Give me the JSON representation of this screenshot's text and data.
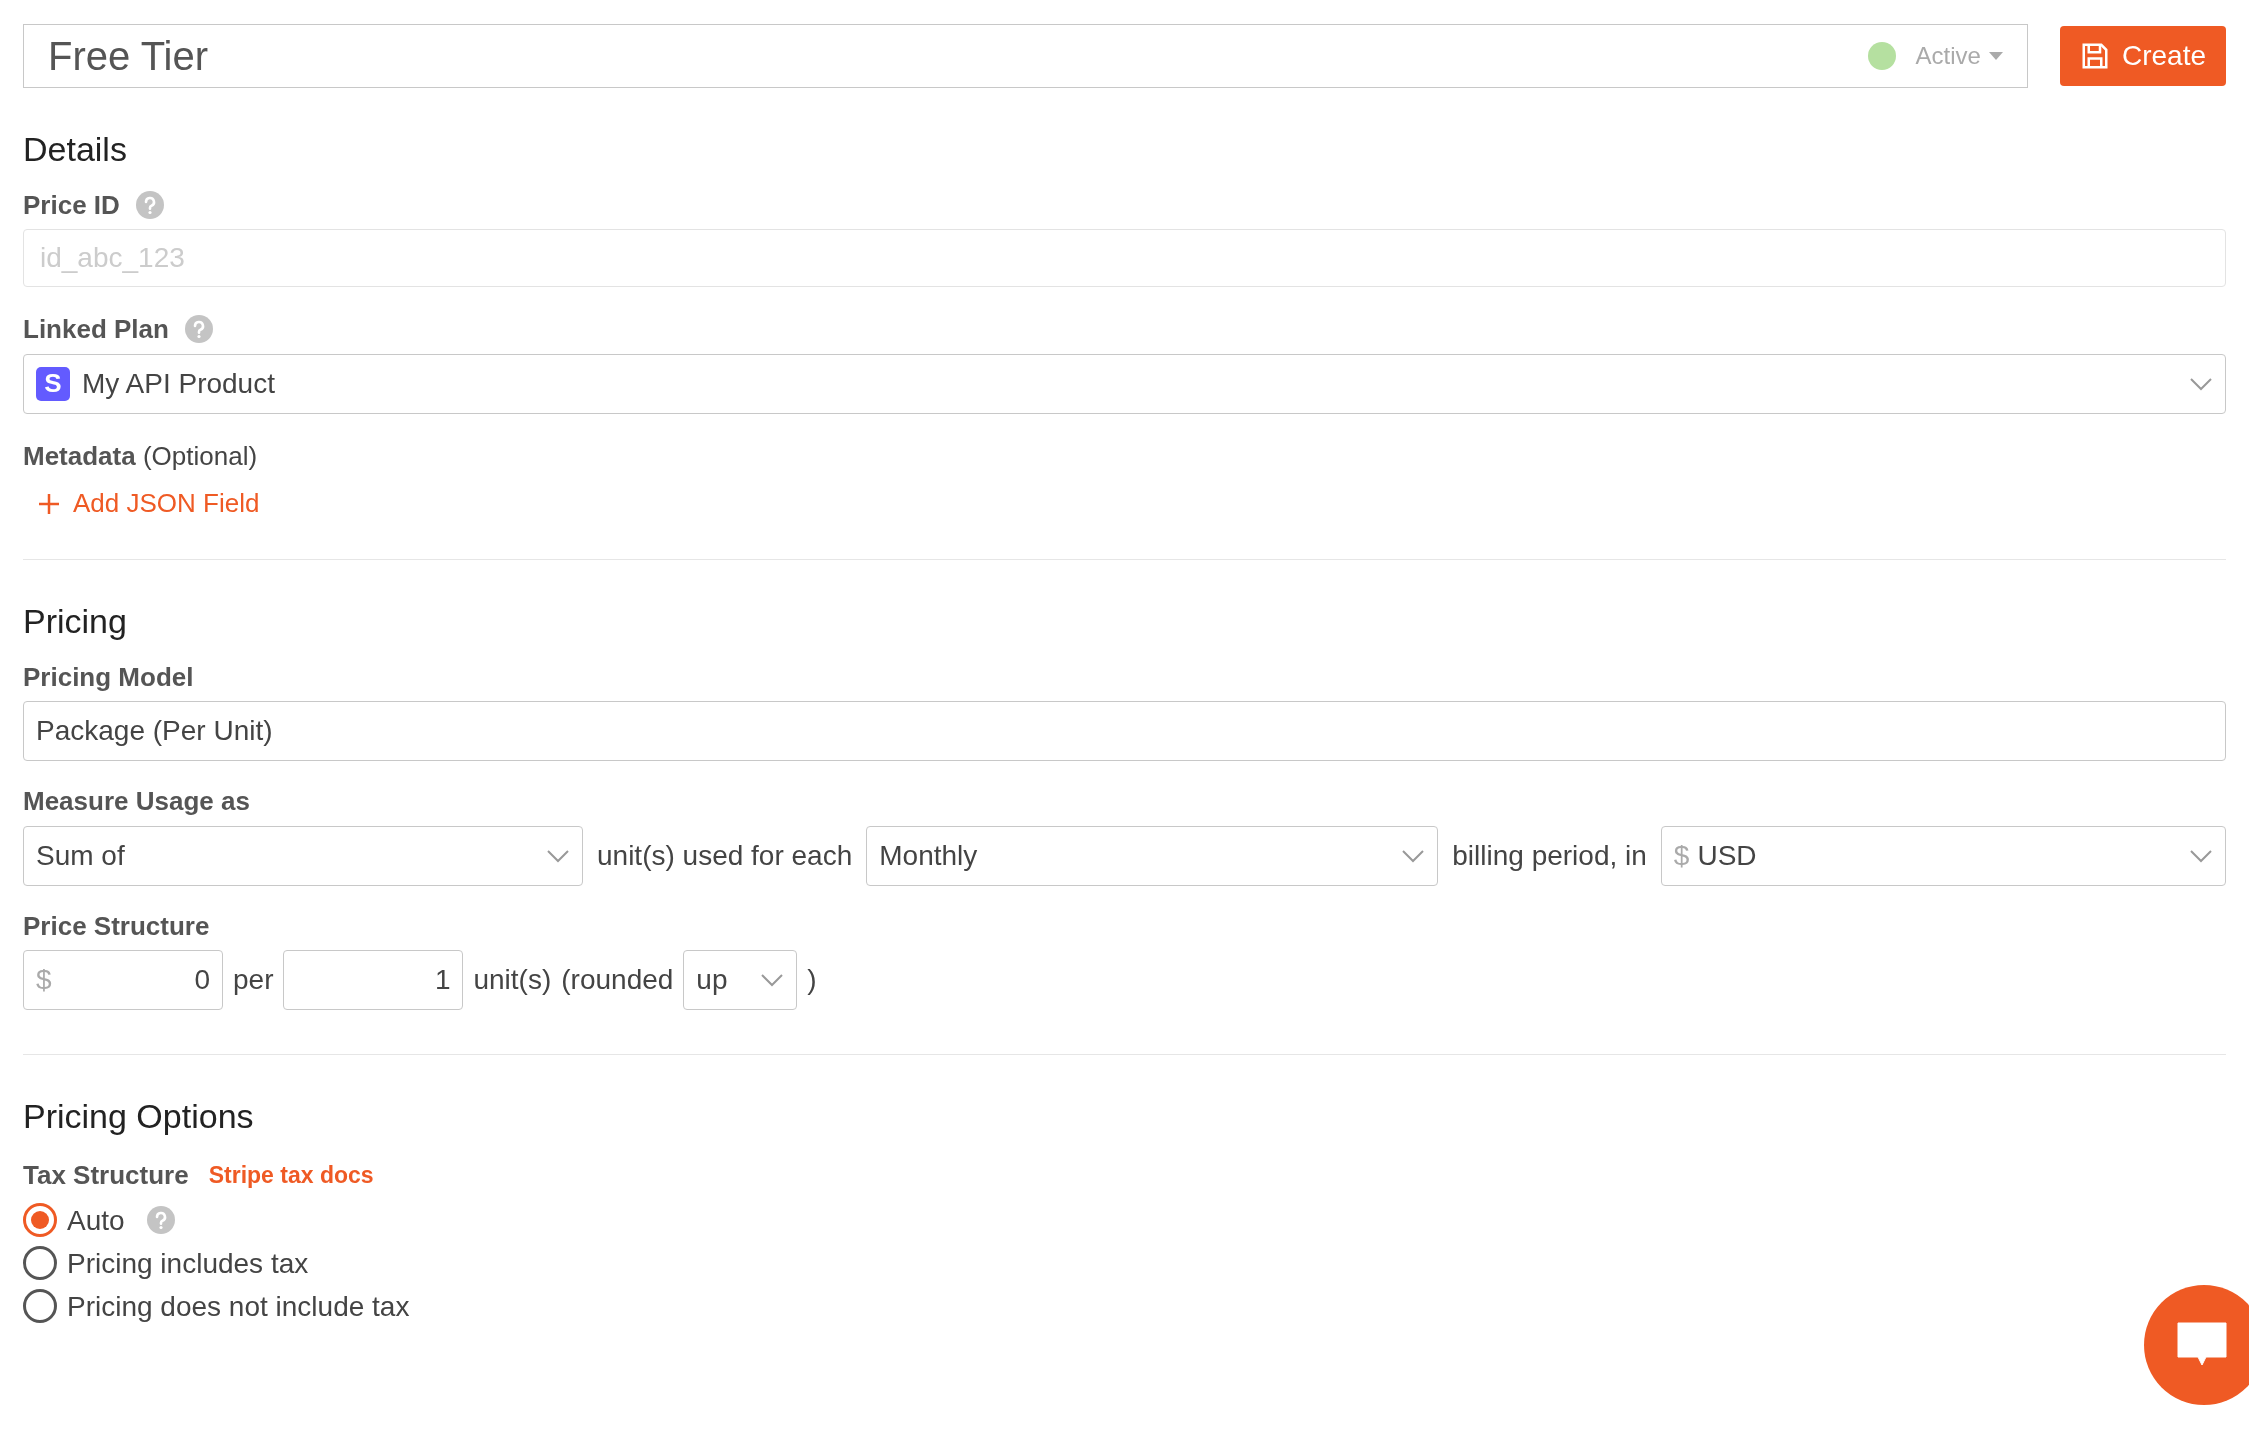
{
  "header": {
    "name": "Free Tier",
    "status": {
      "label": "Active",
      "color": "#b5e0a0"
    },
    "create_button": "Create"
  },
  "details": {
    "title": "Details",
    "price_id": {
      "label": "Price ID",
      "placeholder": "id_abc_123"
    },
    "linked_plan": {
      "label": "Linked Plan",
      "badge": "S",
      "value": "My API Product"
    },
    "metadata": {
      "label": "Metadata",
      "optional": "(Optional)",
      "add_button": "Add JSON Field"
    }
  },
  "pricing": {
    "title": "Pricing",
    "pricing_model": {
      "label": "Pricing Model",
      "value": "Package (Per Unit)"
    },
    "measure_usage": {
      "label": "Measure Usage as",
      "aggregate": "Sum of",
      "text_1": "unit(s) used for each",
      "period": "Monthly",
      "text_2": "billing period, in",
      "currency_symbol": "$",
      "currency": "USD"
    },
    "price_structure": {
      "label": "Price Structure",
      "currency_symbol": "$",
      "amount": "0",
      "text_1": "per",
      "units": "1",
      "text_2": "unit(s)",
      "text_3": "(rounded",
      "rounding": "up",
      "text_4": ")"
    }
  },
  "pricing_options": {
    "title": "Pricing Options",
    "tax_structure": {
      "label": "Tax Structure",
      "link": "Stripe tax docs",
      "options": [
        {
          "label": "Auto",
          "selected": true,
          "help": true
        },
        {
          "label": "Pricing includes tax",
          "selected": false,
          "help": false
        },
        {
          "label": "Pricing does not include tax",
          "selected": false,
          "help": false
        }
      ]
    }
  }
}
